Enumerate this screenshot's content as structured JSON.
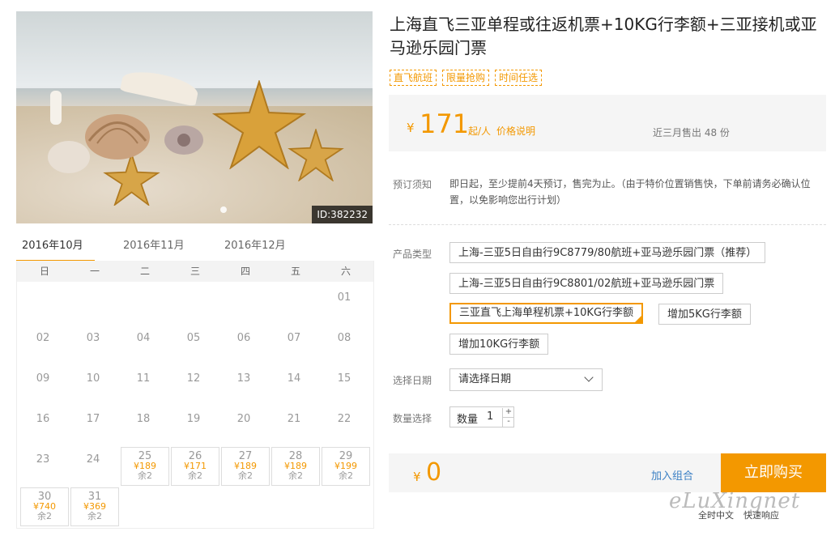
{
  "gallery": {
    "id_badge": "ID:382232"
  },
  "months": [
    "2016年10月",
    "2016年11月",
    "2016年12月"
  ],
  "weekdays": [
    "日",
    "一",
    "二",
    "三",
    "四",
    "五",
    "六"
  ],
  "calendar": {
    "plain_days": [
      "01",
      "02",
      "03",
      "04",
      "05",
      "06",
      "07",
      "08",
      "09",
      "10",
      "11",
      "12",
      "13",
      "14",
      "15",
      "16",
      "17",
      "18",
      "19",
      "20",
      "21",
      "22",
      "23",
      "24"
    ],
    "avail_days": [
      {
        "day": "25",
        "price": "¥189",
        "stock": "余2"
      },
      {
        "day": "26",
        "price": "¥171",
        "stock": "余2"
      },
      {
        "day": "27",
        "price": "¥189",
        "stock": "余2"
      },
      {
        "day": "28",
        "price": "¥189",
        "stock": "余2"
      },
      {
        "day": "29",
        "price": "¥199",
        "stock": "余2"
      },
      {
        "day": "30",
        "price": "¥740",
        "stock": "余2"
      },
      {
        "day": "31",
        "price": "¥369",
        "stock": "余2"
      }
    ]
  },
  "product": {
    "title": "上海直飞三亚单程或往返机票+10KG行李额+三亚接机或亚马逊乐园门票",
    "tags": [
      "直飞航班",
      "限量抢购",
      "时间任选"
    ],
    "price": {
      "currency": "¥",
      "amount": "171",
      "unit": "起/人",
      "price_note": "价格说明",
      "sold": "近三月售出 48 份"
    },
    "notice_label": "预订须知",
    "notice_text": "即日起，至少提前4天预订，售完为止。（由于特价位置销售快，下单前请务必确认位置，以免影响您出行计划）",
    "type_label": "产品类型",
    "types": [
      "上海-三亚5日自由行9C8779/80航班+亚马逊乐园门票（推荐）",
      "上海-三亚5日自由行9C8801/02航班+亚马逊乐园门票",
      "三亚直飞上海单程机票+10KG行李额",
      "增加5KG行李额",
      "增加10KG行李额"
    ],
    "date_label": "选择日期",
    "date_placeholder": "请选择日期",
    "qty_label": "数量选择",
    "qty_text": "数量",
    "qty_value": "1",
    "plus": "+",
    "minus": "-"
  },
  "buy": {
    "currency": "¥",
    "total": "0",
    "combo": "加入组合",
    "buy_now": "立即购买"
  },
  "watermark": "eLuXingnet",
  "footer": [
    "全时中文",
    "快速响应"
  ]
}
